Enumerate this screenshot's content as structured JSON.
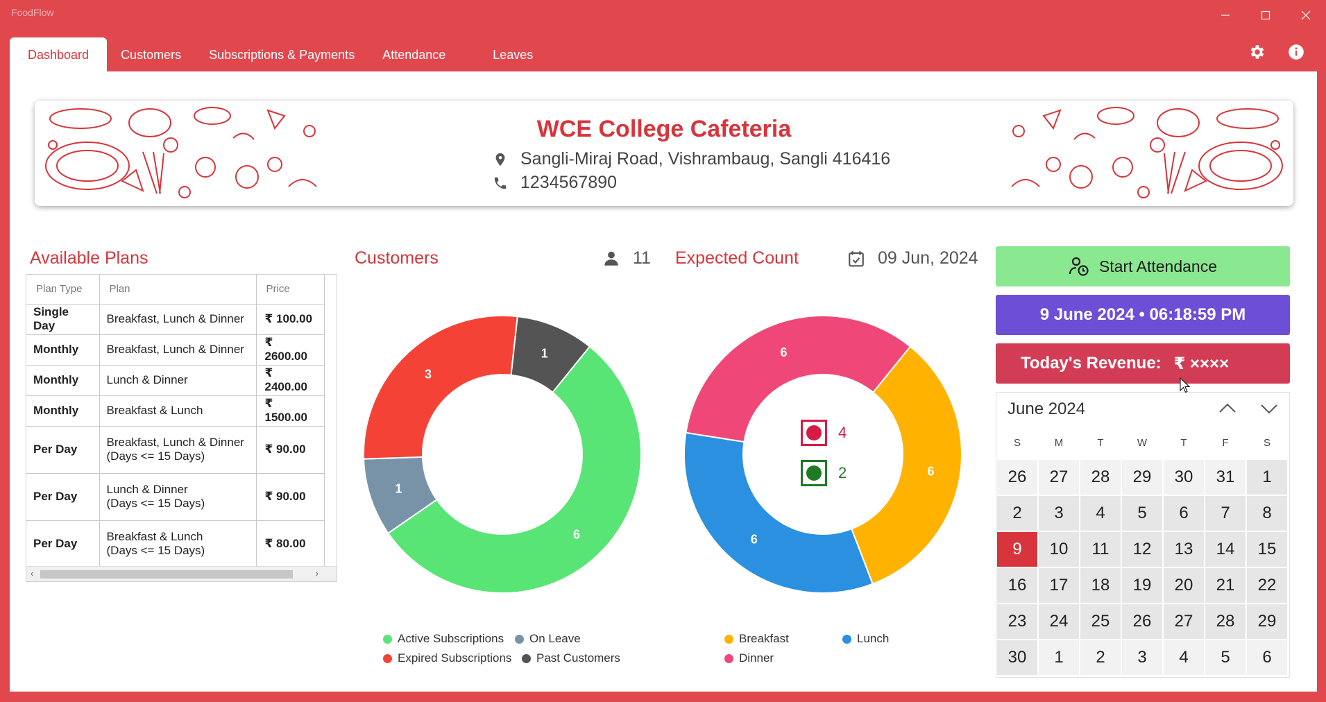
{
  "app": {
    "title": "FoodFlow"
  },
  "tabs": [
    {
      "label": "Dashboard"
    },
    {
      "label": "Customers"
    },
    {
      "label": "Subscriptions & Payments"
    },
    {
      "label": "Attendance"
    },
    {
      "label": "Leaves"
    }
  ],
  "icons": {
    "settings": "gear-icon",
    "info": "info-icon",
    "location": "location-pin-icon",
    "phone": "phone-icon",
    "person": "person-icon",
    "calendar": "calendar-check-icon",
    "attendance": "user-clock-icon"
  },
  "banner": {
    "name": "WCE College Cafeteria",
    "address": "Sangli-Miraj Road, Vishrambaug, Sangli 416416",
    "phone": "1234567890"
  },
  "plans": {
    "title": "Available Plans",
    "headers": [
      "Plan Type",
      "Plan",
      "Price"
    ],
    "rows": [
      {
        "type": "Single Day",
        "plan": "Breakfast, Lunch & Dinner",
        "plan2": "",
        "price": "₹ 100.00"
      },
      {
        "type": "Monthly",
        "plan": "Breakfast, Lunch & Dinner",
        "plan2": "",
        "price": "₹ 2600.00"
      },
      {
        "type": "Monthly",
        "plan": "Lunch & Dinner",
        "plan2": "",
        "price": "₹ 2400.00"
      },
      {
        "type": "Monthly",
        "plan": "Breakfast & Lunch",
        "plan2": "",
        "price": "₹ 1500.00"
      },
      {
        "type": "Per Day",
        "plan": "Breakfast, Lunch & Dinner",
        "plan2": "(Days <= 15 Days)",
        "price": "₹ 90.00"
      },
      {
        "type": "Per Day",
        "plan": "Lunch & Dinner",
        "plan2": "(Days <= 15 Days)",
        "price": "₹ 90.00"
      },
      {
        "type": "Per Day",
        "plan": "Breakfast & Lunch",
        "plan2": "(Days <= 15 Days)",
        "price": "₹ 80.00"
      }
    ]
  },
  "customers": {
    "title": "Customers",
    "count": "11"
  },
  "expected": {
    "title": "Expected Count",
    "date": "09 Jun, 2024",
    "nonveg_count": "4",
    "veg_count": "2"
  },
  "colors": {
    "brand": "#d8343b",
    "active": "#58e575",
    "expired": "#f44336",
    "onleave": "#7893a8",
    "past": "#545454",
    "breakfast": "#ffb300",
    "lunch": "#2b90e0",
    "dinner": "#ef4878",
    "nonveg": "#d81b45",
    "veg": "#1f7a24"
  },
  "chart_data": [
    {
      "type": "pie",
      "labels": [
        "Active Subscriptions",
        "Expired Subscriptions",
        "On Leave",
        "Past Customers"
      ],
      "values": [
        6,
        3,
        1,
        1
      ],
      "colors": [
        "#58e575",
        "#f44336",
        "#7893a8",
        "#545454"
      ]
    },
    {
      "type": "pie",
      "labels": [
        "Breakfast",
        "Lunch",
        "Dinner"
      ],
      "values": [
        6,
        6,
        6
      ],
      "colors": [
        "#ffb300",
        "#2b90e0",
        "#ef4878"
      ]
    }
  ],
  "attendance": {
    "start_label": "Start Attendance",
    "clock": "9 June 2024 • 06:18:59 PM",
    "revenue_label": "Today's Revenue:",
    "revenue_value": "₹ ××××"
  },
  "calendar": {
    "month": "June 2024",
    "dow": [
      "S",
      "M",
      "T",
      "W",
      "T",
      "F",
      "S"
    ],
    "days": [
      [
        "26",
        "27",
        "28",
        "29",
        "30",
        "31",
        "1"
      ],
      [
        "2",
        "3",
        "4",
        "5",
        "6",
        "7",
        "8"
      ],
      [
        "9",
        "10",
        "11",
        "12",
        "13",
        "14",
        "15"
      ],
      [
        "16",
        "17",
        "18",
        "19",
        "20",
        "21",
        "22"
      ],
      [
        "23",
        "24",
        "25",
        "26",
        "27",
        "28",
        "29"
      ],
      [
        "30",
        "1",
        "2",
        "3",
        "4",
        "5",
        "6"
      ]
    ],
    "today": "9"
  }
}
